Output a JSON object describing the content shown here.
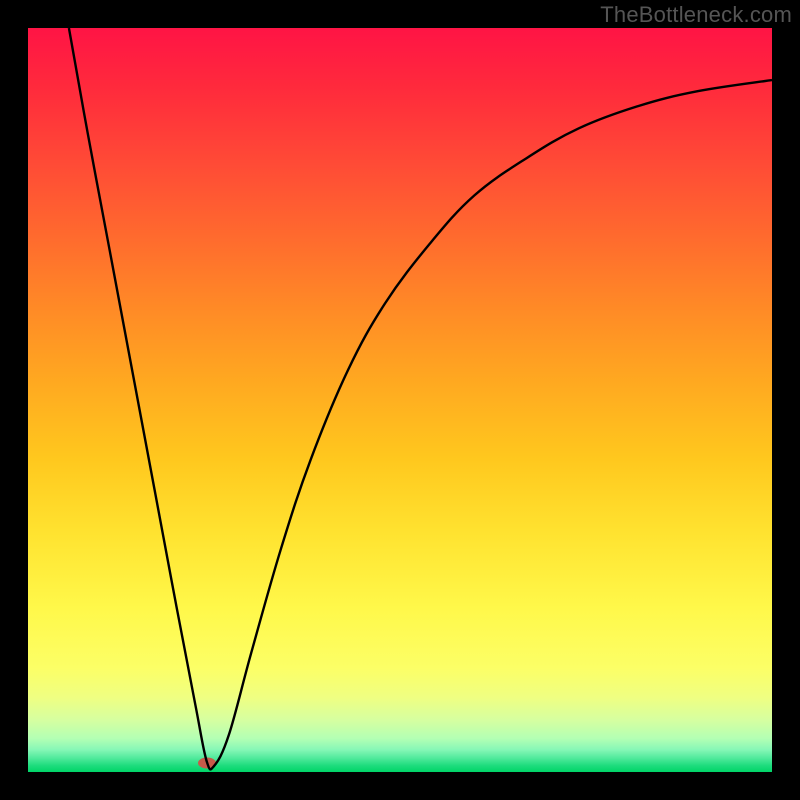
{
  "watermark": "TheBottleneck.com",
  "colors": {
    "page_bg": "#000000",
    "watermark_text": "#555555",
    "curve_stroke": "#000000",
    "marker_fill": "#c85a4a",
    "gradient_top": "#ff1445",
    "gradient_mid": "#ffd633",
    "gradient_bottom": "#00d568"
  },
  "chart_data": {
    "type": "line",
    "title": "",
    "xlabel": "",
    "ylabel": "",
    "xlim": [
      0,
      100
    ],
    "ylim": [
      0,
      100
    ],
    "grid": false,
    "legend": false,
    "annotations": [],
    "marker": {
      "x": 24,
      "y": 1.2
    },
    "series": [
      {
        "name": "curve",
        "x": [
          5.5,
          8,
          11,
          14,
          17,
          20,
          22.5,
          24,
          25,
          27,
          30,
          34,
          38,
          43,
          48,
          54,
          60,
          67,
          74,
          82,
          90,
          100
        ],
        "values": [
          100,
          86,
          70,
          54,
          38,
          22,
          9,
          1.5,
          0.8,
          5,
          16,
          30,
          42,
          54,
          63,
          71,
          77.5,
          82.5,
          86.5,
          89.5,
          91.5,
          93
        ]
      }
    ]
  }
}
